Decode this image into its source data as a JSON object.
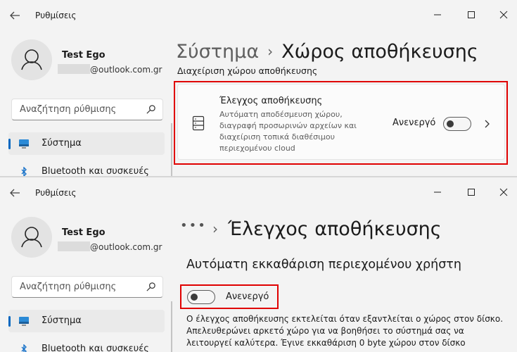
{
  "window": {
    "app_title": "Ρυθμίσεις"
  },
  "user": {
    "name": "Test Ego",
    "email_suffix": "@outlook.com.gr"
  },
  "search": {
    "placeholder": "Αναζήτηση ρύθμισης"
  },
  "sidebar": {
    "items": [
      {
        "label": "Σύστημα",
        "icon": "monitor-icon",
        "active": true
      },
      {
        "label": "Bluetooth και συσκευές",
        "icon": "bluetooth-icon",
        "active": false
      }
    ]
  },
  "panel1": {
    "breadcrumb_parent": "Σύστημα",
    "breadcrumb_separator": "›",
    "page_title": "Χώρος αποθήκευσης",
    "section_title": "Διαχείριση χώρου αποθήκευσης",
    "card": {
      "title": "Έλεγχος αποθήκευσης",
      "description": "Αυτόματη αποδέσμευση χώρου, διαγραφή προσωρινών αρχείων και διαχείριση τοπικά διαθέσιμου περιεχομένου cloud",
      "state_label": "Ανενεργό",
      "toggle_on": false,
      "icon": "storage-drive-icon"
    }
  },
  "panel2": {
    "breadcrumb_overflow": "•••",
    "breadcrumb_separator": "›",
    "page_title": "Έλεγχος αποθήκευσης",
    "section_title": "Αυτόματη εκκαθάριση περιεχομένου χρήστη",
    "toggle_label": "Ανενεργό",
    "toggle_on": false,
    "description": "Ο έλεγχος αποθήκευσης εκτελείται όταν εξαντλείται ο χώρος στον δίσκο. Απελευθερώνει αρκετό χώρο για να βοηθήσει το σύστημά σας να λειτουργεί καλύτερα. Έγινε εκκαθάριση 0 byte χώρου στον δίσκο"
  },
  "colors": {
    "accent": "#0067c0",
    "highlight": "#e00000",
    "background": "#f3f3f3"
  }
}
